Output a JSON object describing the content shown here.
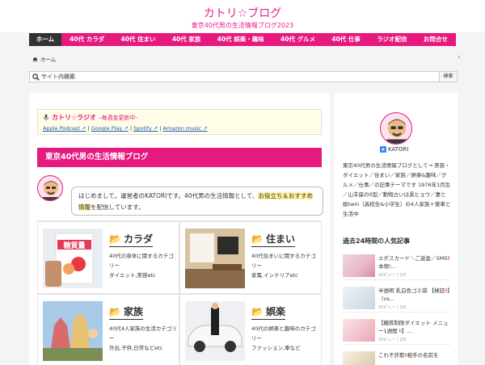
{
  "site": {
    "title": "カトリ☆ブログ",
    "description": "東京40代男の生活情報ブログ2023"
  },
  "nav": [
    "ホーム",
    "40代 カラダ",
    "40代 住まい",
    "40代 家族",
    "40代 娯楽・趣味",
    "40代 グルメ",
    "40代 仕事",
    "ラジオ配信",
    "お問合せ"
  ],
  "breadcrumb": {
    "home": "ホーム"
  },
  "search": {
    "placeholder": "サイト内検索",
    "button": "検索"
  },
  "radio": {
    "title": "カトリ☆ラジオ",
    "subtitle": "–毎週金更新中-",
    "links": [
      "Apple Podcast ↗",
      "Google Play ↗",
      "Spotify ↗",
      "Amazon music ↗"
    ],
    "separator": " | "
  },
  "main": {
    "section_title": "東京40代男の生活情報ブログ",
    "intro_pre": "はじめまして。運営者のKATORIです。40代男の生活情報として、",
    "intro_hl": "お役立ち＆おすすめ情報",
    "intro_post": "を配信しています。",
    "categories": [
      {
        "title": "カラダ",
        "desc": "40代の身体に関するカテゴリー\nダイエット,美容etc",
        "img_label": "糖質量"
      },
      {
        "title": "住まい",
        "desc": "40代住まいに関するカテゴリー\n家電,インテリアetc",
        "img_label": ""
      },
      {
        "title": "家族",
        "desc": "40代4人家族の生活カテゴリー\n外出,子供,日常などetc",
        "img_label": ""
      },
      {
        "title": "娯楽",
        "desc": "40代の娯楽と趣味のカテゴリー\nファッション,車など",
        "img_label": ""
      }
    ]
  },
  "sidebar": {
    "profile_name": "KATORI",
    "profile_text": "東京40代男の生活情報ブログとして→ 美容・ダイエット／住まい／家族／娯楽&趣味／グルメ／仕事／の記事テーマです 1976年1月生／山羊座の0型／動物占いは黒ヒョウ／妻と娘twin（高校生&小学生）の4人家族＋愛車と生活中",
    "popular_title": "過去24時間の人気記事",
    "popular": [
      {
        "pre": "エポスカード",
        "mid": "＼ご返金／SMS",
        "excl": "‼",
        "post": "本物!...",
        "views": "32ビュー / 1日"
      },
      {
        "pre": "半透明 乳白色ゴミ袋 【検証",
        "mid": "】（vs...",
        "excl": "",
        "post": "",
        "views": "25ビュー / 1日"
      },
      {
        "pre": "【糖質制限ダイエット メニュー1週間 ",
        "mid": "】...",
        "excl": "",
        "post": "",
        "views": "20ビュー / 1日"
      },
      {
        "pre": "これぞ詐欺",
        "mid": "",
        "excl": "‼",
        "post": "相手の名前を",
        "views": ""
      }
    ]
  },
  "colors": {
    "accent": "#e6197e",
    "nav_active": "#333333",
    "highlight": "#fff59d"
  }
}
